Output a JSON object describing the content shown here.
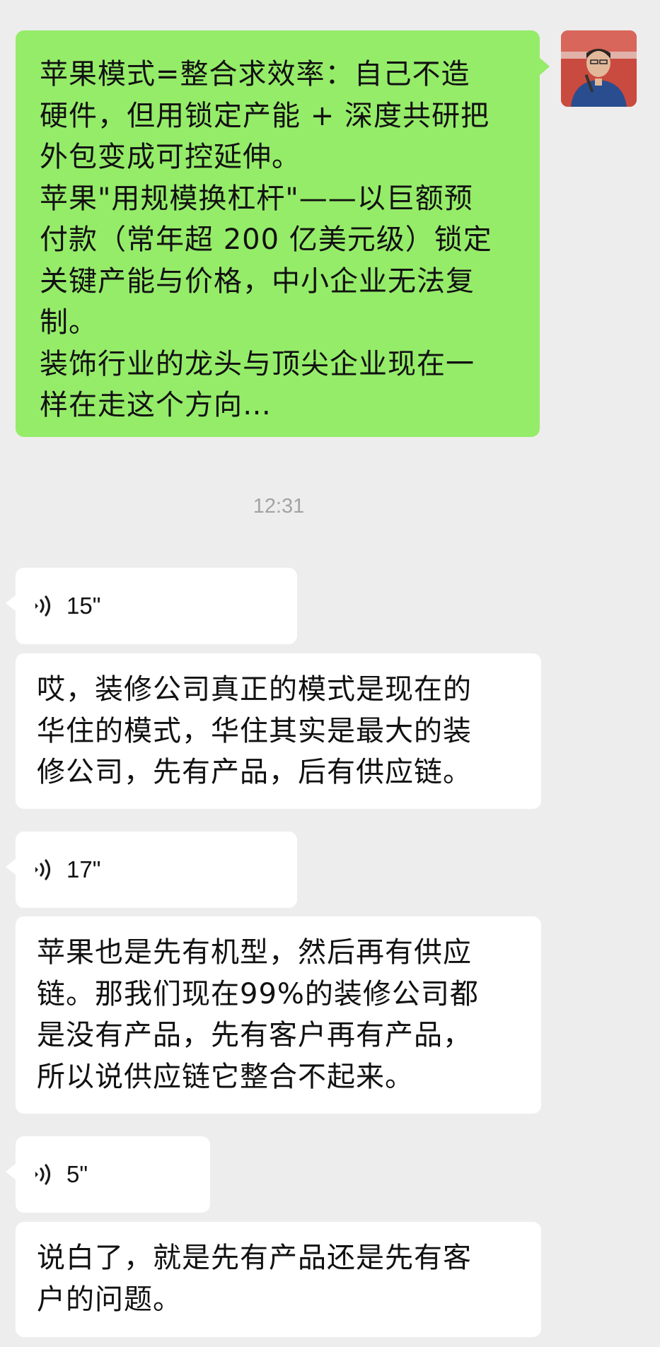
{
  "chat": {
    "sent_message": "苹果模式=整合求效率：自己不造\n硬件，但用锁定产能 + 深度共研把\n外包变成可控延伸。\n苹果\"用规模换杠杆\"——以巨额预\n付款（常年超 200 亿美元级）锁定\n关键产能与价格，中小企业无法复\n制。\n装饰行业的龙头与顶尖企业现在一\n样在走这个方向…",
    "timestamp": "12:31",
    "voice_1": {
      "duration": "15\""
    },
    "text_1": "哎，装修公司真正的模式是现在的\n华住的模式，华住其实是最大的装\n修公司，先有产品，后有供应链。",
    "voice_2": {
      "duration": "17\""
    },
    "text_2": "苹果也是先有机型，然后再有供应\n链。那我们现在99%的装修公司都\n是没有产品，先有客户再有产品，\n所以说供应链它整合不起来。",
    "voice_3": {
      "duration": "5\""
    },
    "text_3": "说白了，就是先有产品还是先有客\n户的问题。"
  },
  "colors": {
    "background": "#ededed",
    "sent_bubble": "#95ec69",
    "received_bubble": "#ffffff",
    "timestamp_text": "#a3a3a3",
    "avatar_bg": "#c94a3e",
    "avatar_shirt": "#2a4d8f"
  },
  "icons": {
    "voice": "voice-wave-icon",
    "avatar": "user-avatar-photo"
  }
}
